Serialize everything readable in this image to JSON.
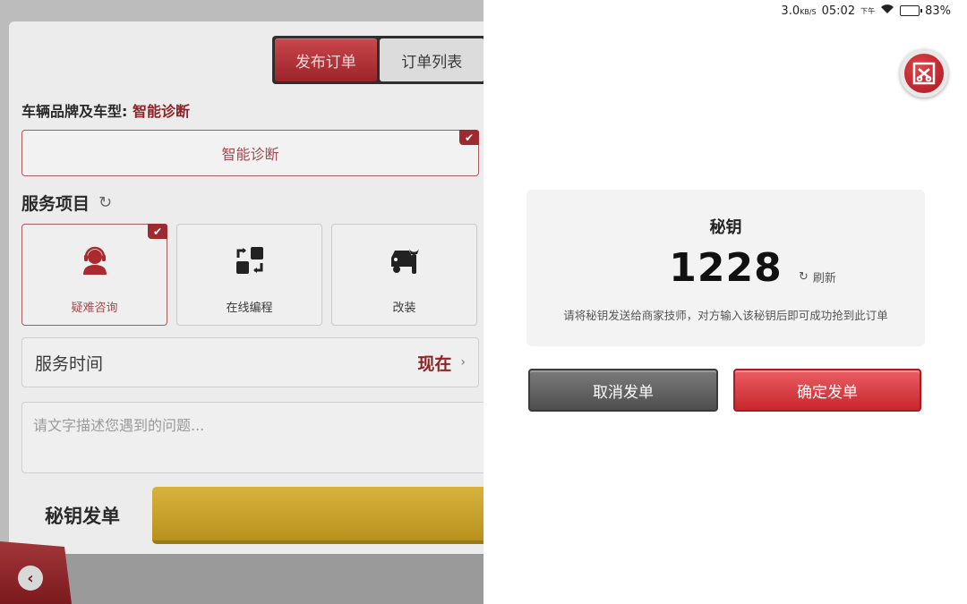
{
  "status_bar": {
    "net_speed": "3.0",
    "net_unit": "KB/S",
    "time": "05:02",
    "ampm": "下午",
    "battery": "83%"
  },
  "app": {
    "tabs": [
      {
        "label": "发布订单",
        "active": true
      },
      {
        "label": "订单列表",
        "active": false
      }
    ],
    "vehicle_prefix": "车辆品牌及车型:",
    "vehicle_value": "智能诊断",
    "diagnosis_box": "智能诊断",
    "services_title": "服务项目",
    "services": [
      {
        "label": "疑难咨询",
        "icon": "support-agent-icon",
        "selected": true
      },
      {
        "label": "在线编程",
        "icon": "programming-swap-icon",
        "selected": false
      },
      {
        "label": "改装",
        "icon": "car-wrench-icon",
        "selected": false
      }
    ],
    "service_time_label": "服务时间",
    "service_time_value": "现在",
    "description_placeholder": "请文字描述您遇到的问题...",
    "key_send_label": "秘钥发单"
  },
  "dialog": {
    "title": "秘钥",
    "code": "1228",
    "refresh_label": "刷新",
    "note": "请将秘钥发送给商家技师，对方输入该秘钥后即可成功抢到此订单",
    "cancel_label": "取消发单",
    "confirm_label": "确定发单"
  },
  "colors": {
    "brand_red": "#c8262d",
    "accent_dark_red": "#8f2327",
    "gold": "#d8b23c"
  }
}
